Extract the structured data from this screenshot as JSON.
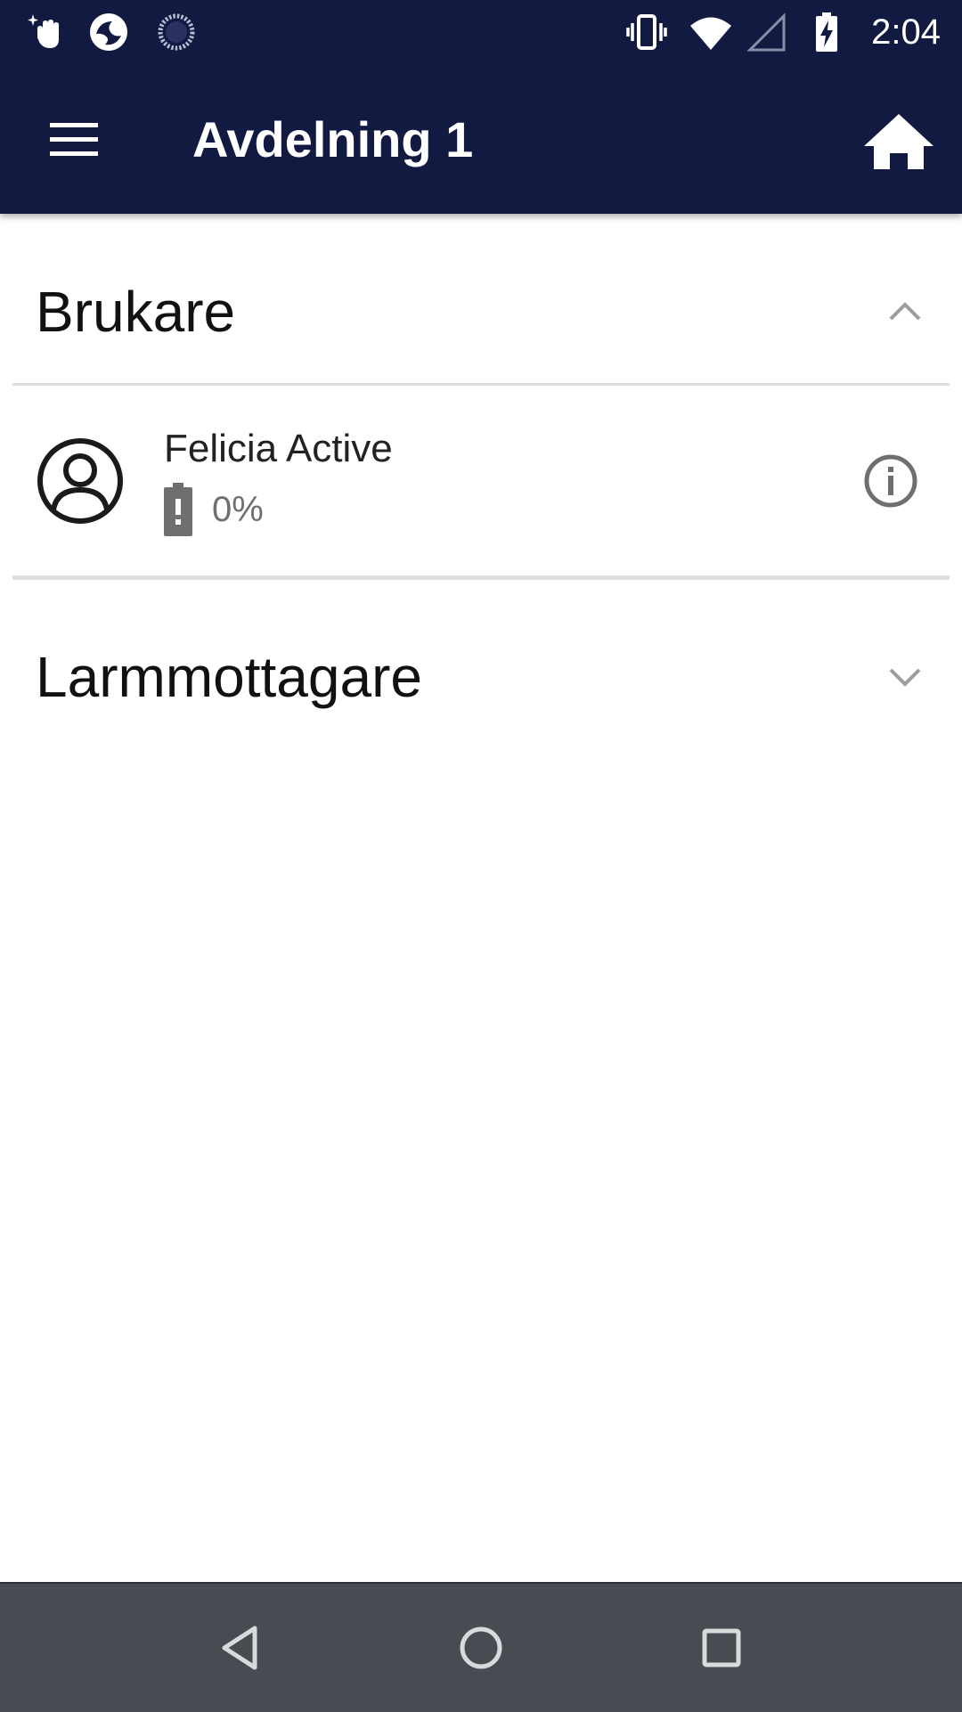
{
  "status_bar": {
    "time": "2:04",
    "left_icons": [
      "hand-sparkle-icon",
      "app-logo-icon",
      "sync-spinner-icon"
    ],
    "right_icons": [
      "vibrate-icon",
      "wifi-icon",
      "cell-signal-icon",
      "battery-charging-icon"
    ]
  },
  "app_bar": {
    "title": "Avdelning 1",
    "menu_icon": "hamburger-menu-icon",
    "home_icon": "home-icon",
    "background": "#131a42"
  },
  "sections": {
    "brukare": {
      "title": "Brukare",
      "expanded": true,
      "items": [
        {
          "name": "Felicia Active",
          "battery": "0%",
          "battery_icon": "battery-alert-icon",
          "info_icon": "info-icon"
        }
      ]
    },
    "larmmottagare": {
      "title": "Larmmottagare",
      "expanded": false
    }
  },
  "nav_bar": {
    "buttons": [
      "back-icon",
      "home-circle-icon",
      "recents-icon"
    ]
  }
}
